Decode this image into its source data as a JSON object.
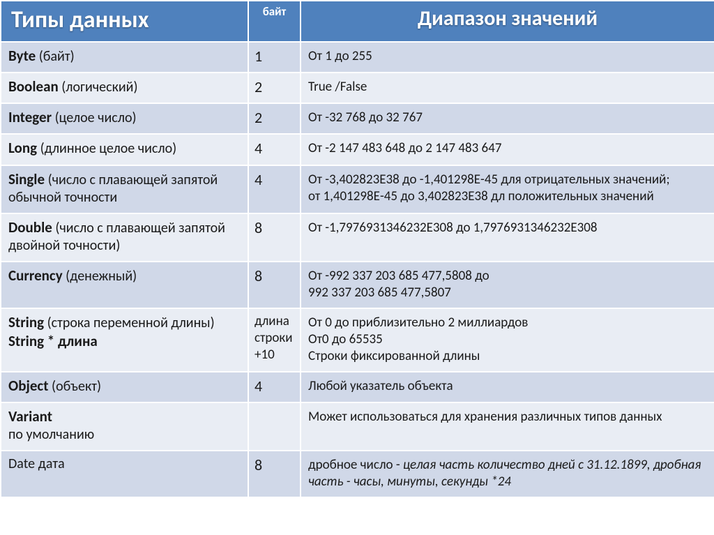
{
  "headers": {
    "types": "Типы данных",
    "bytes": "байт",
    "range": "Диапазон значений"
  },
  "rows": [
    {
      "name": "Byte",
      "desc": " (байт)",
      "sub": "",
      "bytes": "1",
      "range": "От 1 до 255"
    },
    {
      "name": "Boolean",
      "desc": " (логический)",
      "sub": "",
      "bytes": "2",
      "range": "True /False"
    },
    {
      "name": "Integer",
      "desc": " (целое число)",
      "sub": "",
      "bytes": "2",
      "range": "От -32 768 до 32 767"
    },
    {
      "name": "Long",
      "desc": " (длинное целое число)",
      "sub": "",
      "bytes": "4",
      "range": "От -2 147 483 648 до 2 147 483 647"
    },
    {
      "name": "Single",
      "desc": " (число с плавающей запятой обычной точности",
      "sub": "",
      "bytes": "4",
      "range": "От -3,402823Е38 до -1,401298Е-45 для отрицательных значений;\nот 1,401298Е-45 до 3,402823Е38 дл положительных значений"
    },
    {
      "name": "Double",
      "desc": " (число с плавающей запятой двойной точности)",
      "sub": "",
      "bytes": "8",
      "range": "От -1,7976931346232Е308 до 1,7976931346232Е308"
    },
    {
      "name": "Currency",
      "desc": " (денежный)",
      "sub": "",
      "bytes": "8",
      "range": "От -992 337 203 685 477,5808 до\n992 337 203 685 477,5807"
    },
    {
      "name": "String",
      "desc": " (строка переменной длины)",
      "sub": "String * длина",
      "bytes": "длина строки +10",
      "range": "От 0 до приблизительно 2 миллиардов\nОт0 до 65535\nСтроки фиксированной длины"
    },
    {
      "name": "Object",
      "desc": " (объект)",
      "sub": "",
      "bytes": "4",
      "range": "Любой указатель объекта"
    },
    {
      "name": "Variant",
      "desc": "",
      "sub": "по умолчанию",
      "bytes": "",
      "range": "Может использоваться для        хранения различных типов данных"
    },
    {
      "name": "",
      "desc": "Date  дата",
      "sub": "",
      "bytes": "8",
      "range_prefix": "дробное число - ",
      "range_italic": "целая часть количество дней с 31.12.1899, дробная часть - часы, минуты, секунды *24"
    }
  ]
}
